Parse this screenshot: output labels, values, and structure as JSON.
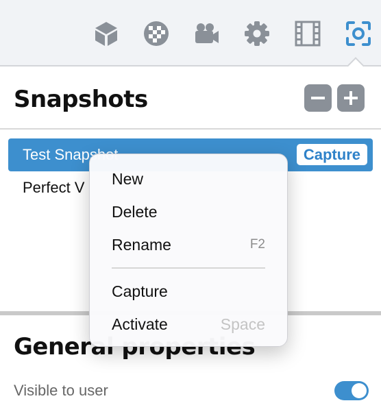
{
  "toolbar": {
    "tools": [
      {
        "icon": "cube-icon"
      },
      {
        "icon": "texture-ball-icon"
      },
      {
        "icon": "video-camera-icon"
      },
      {
        "icon": "gear-icon"
      },
      {
        "icon": "film-strip-icon"
      },
      {
        "icon": "snapshot-focus-icon",
        "active": true
      }
    ],
    "colors": {
      "icon": "#8a9098",
      "active": "#3d8fce"
    }
  },
  "snapshots": {
    "title": "Snapshots",
    "items": [
      {
        "label": "Test Snapshot",
        "selected": true,
        "action_label": "Capture"
      },
      {
        "label": "Perfect V",
        "selected": false
      }
    ]
  },
  "context_menu": {
    "items": [
      {
        "label": "New",
        "shortcut": ""
      },
      {
        "label": "Delete",
        "shortcut": ""
      },
      {
        "label": "Rename",
        "shortcut": "F2"
      },
      {
        "label": "Capture",
        "shortcut": ""
      },
      {
        "label": "Activate",
        "shortcut": "Space",
        "shortcut_disabled": true
      }
    ]
  },
  "general": {
    "title": "General properties",
    "visible_to_user": {
      "label": "Visible to user",
      "value": true
    }
  },
  "colors": {
    "accent": "#3d8fce",
    "toolbar_bg": "#f1f3f6"
  }
}
